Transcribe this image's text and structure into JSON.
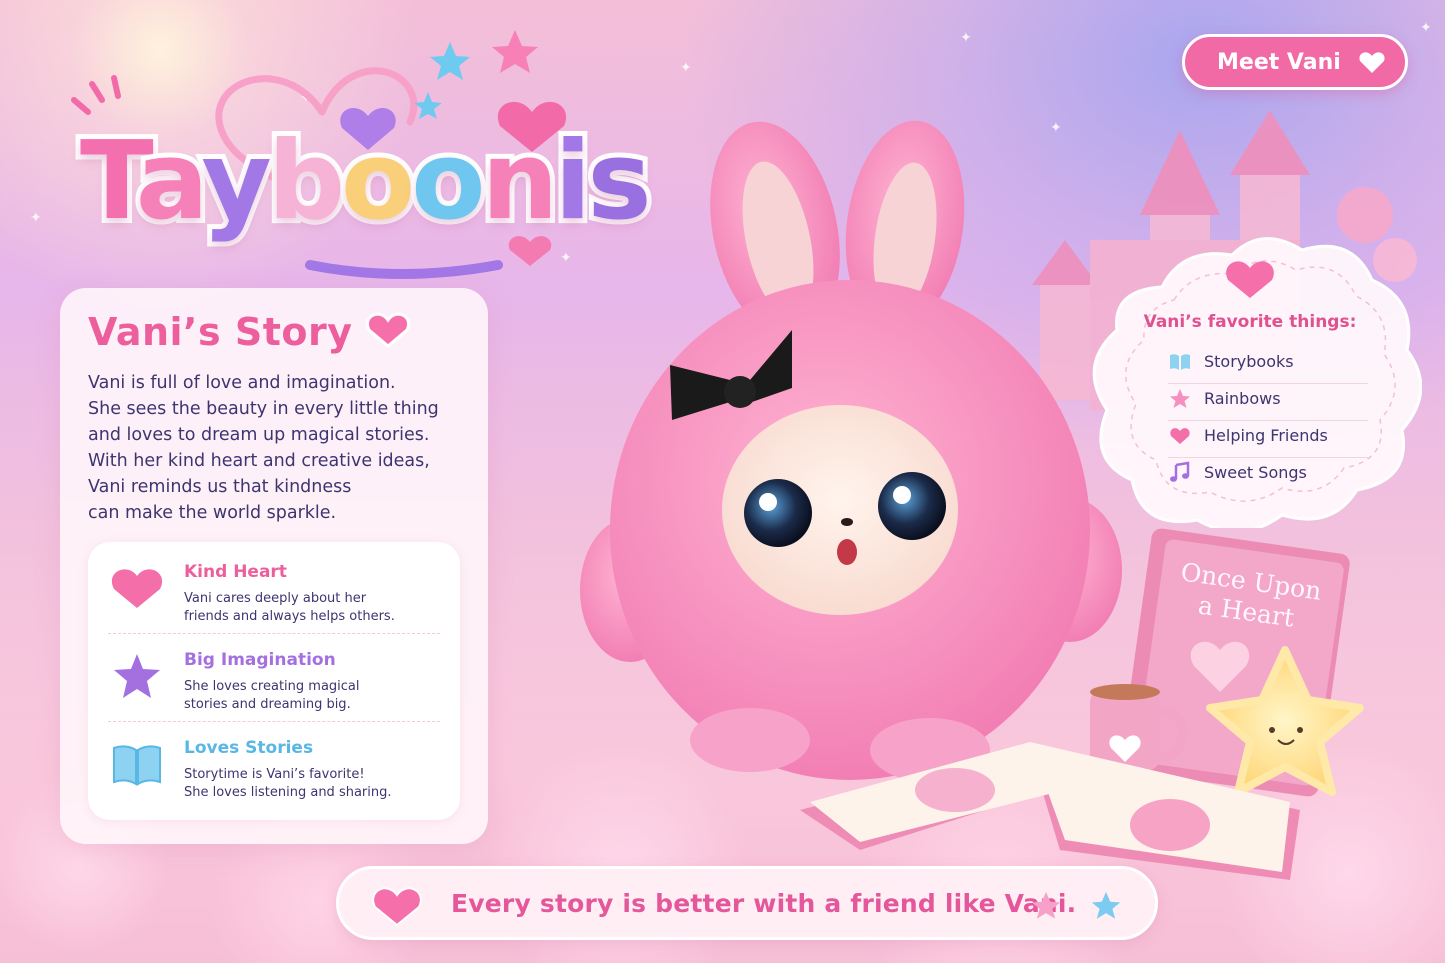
{
  "brand": {
    "logo_text": "Tayboonis",
    "letters": [
      {
        "ch": "T",
        "color": "#f46fae"
      },
      {
        "ch": "a",
        "color": "#f680b8"
      },
      {
        "ch": "y",
        "color": "#a277e6"
      },
      {
        "ch": "b",
        "color": "#f6b3d6"
      },
      {
        "ch": "o",
        "color": "#f9cf7a"
      },
      {
        "ch": "o",
        "color": "#6fc6ee"
      },
      {
        "ch": "n",
        "color": "#f680b8"
      },
      {
        "ch": "i",
        "color": "#a277e6"
      },
      {
        "ch": "s",
        "color": "#9a6fe0"
      }
    ]
  },
  "header": {
    "meet_button_label": "Meet Vani"
  },
  "story": {
    "title": "Vani’s Story",
    "body_lines": [
      "Vani is full of love and imagination.",
      "She sees the beauty in every little thing",
      "and loves to dream up magical stories.",
      "With her kind heart and creative ideas,",
      "Vani reminds us that kindness",
      "can make the world sparkle."
    ],
    "traits": [
      {
        "title": "Kind Heart",
        "icon": "heart-icon",
        "color": "#ec5f9c",
        "desc_lines": [
          "Vani cares deeply about her",
          "friends and always helps others."
        ]
      },
      {
        "title": "Big Imagination",
        "icon": "star-icon",
        "color": "#a470e0",
        "desc_lines": [
          "She loves creating magical",
          "stories and dreaming big."
        ]
      },
      {
        "title": "Loves Stories",
        "icon": "book-icon",
        "color": "#58b7e4",
        "desc_lines": [
          "Storytime is Vani’s favorite!",
          "She loves listening and sharing."
        ]
      }
    ]
  },
  "favorites": {
    "title": "Vani’s favorite things:",
    "items": [
      {
        "label": "Storybooks",
        "icon": "book-icon"
      },
      {
        "label": "Rainbows",
        "icon": "star-icon"
      },
      {
        "label": "Helping Friends",
        "icon": "heart-icon"
      },
      {
        "label": "Sweet Songs",
        "icon": "music-note-icon"
      }
    ]
  },
  "scene": {
    "book_title_line1": "Once Upon",
    "book_title_line2": "a Heart"
  },
  "banner": {
    "text": "Every story is better with a friend like Vani."
  },
  "colors": {
    "primary_pink": "#ec5f9c",
    "purple": "#a470e0",
    "blue": "#58b7e4",
    "navy_text": "#3d3570"
  }
}
